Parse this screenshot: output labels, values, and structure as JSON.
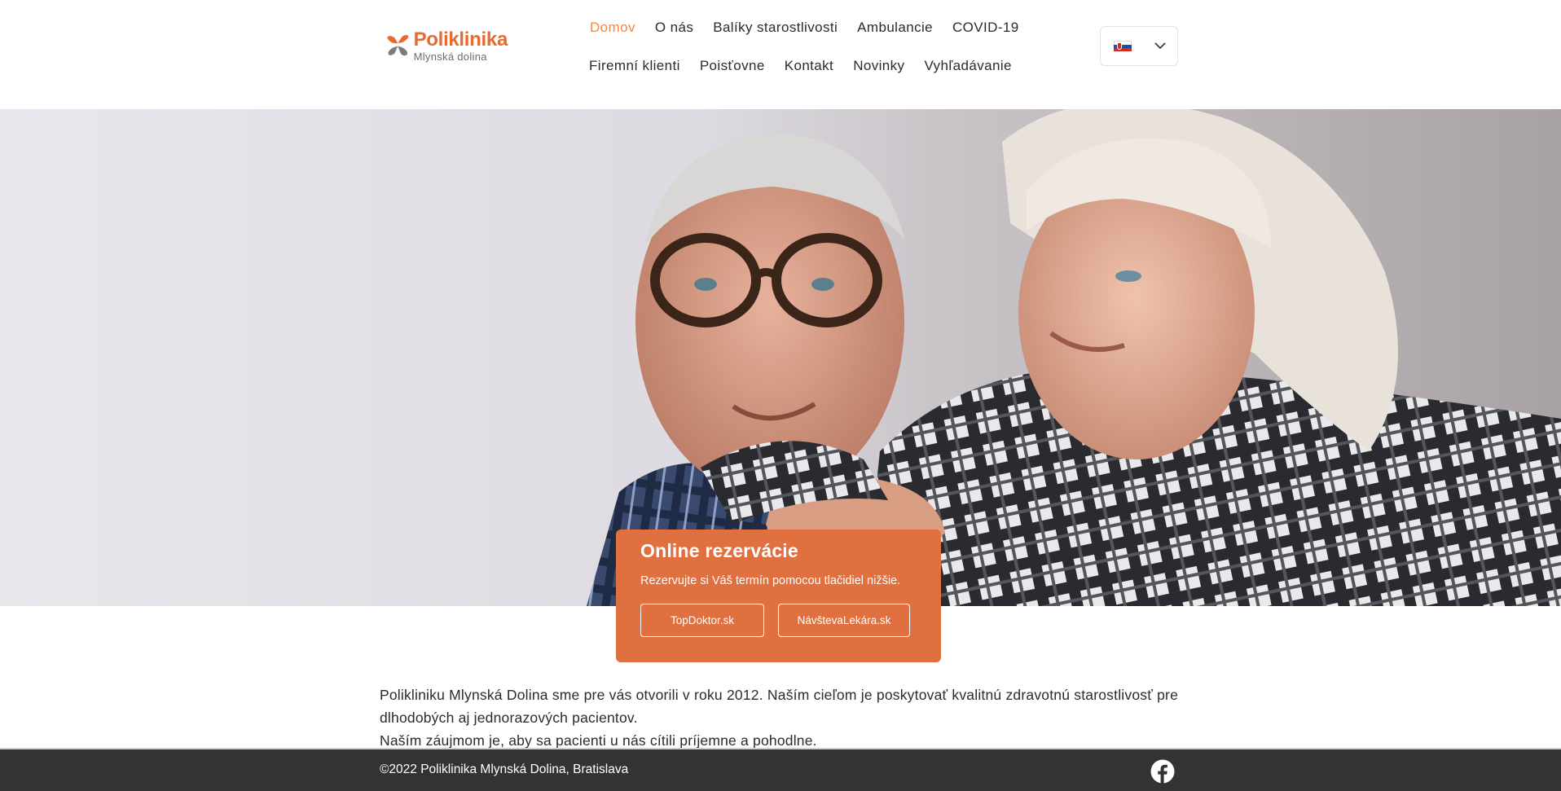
{
  "logo": {
    "title": "Poliklinika",
    "subtitle": "Mlynská dolina"
  },
  "nav": {
    "row1": [
      "Domov",
      "O nás",
      "Balíky starostlivosti",
      "Ambulancie",
      "COVID-19"
    ],
    "row2": [
      "Firemní klienti",
      "Poisťovne",
      "Kontakt",
      "Novinky",
      "Vyhľadávanie"
    ],
    "active": "Domov"
  },
  "language": {
    "flag": "slovakia-flag-icon",
    "selected": "sk"
  },
  "booking": {
    "title": "Online rezervácie",
    "text": "Rezervujte si Váš termín pomocou tlačidiel nižšie.",
    "buttons": [
      "TopDoktor.sk",
      "NávštevaLekára.sk"
    ]
  },
  "intro": {
    "paragraph1": "Polikliniku Mlynská Dolina sme pre vás otvorili v roku 2012. Naším cieľom je poskytovať kvalitnú zdravotnú starostlivosť pre dlhodobých aj jednorazových pacientov.",
    "paragraph2": "Naším záujmom je, aby sa pacienti u nás cítili príjemne a pohodlne."
  },
  "footer": {
    "copyright": "©2022 Poliklinika Mlynská Dolina, Bratislava",
    "social": "facebook-icon"
  },
  "colors": {
    "accent": "#e0703f",
    "nav_active": "#e8894e",
    "footer_bg": "#333333"
  }
}
